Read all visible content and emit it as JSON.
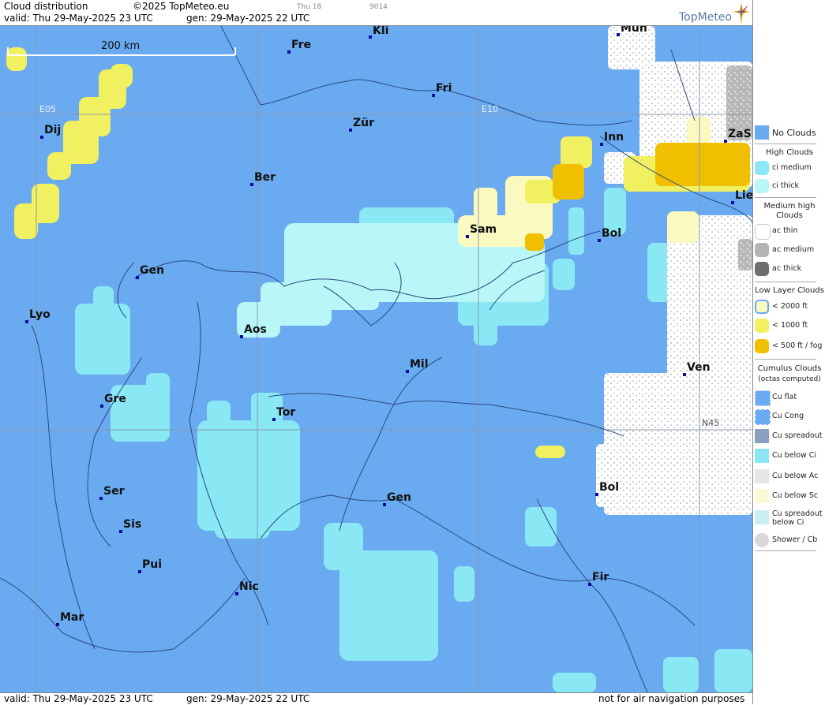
{
  "header": {
    "title": "Cloud distribution",
    "copyright": "©2025 TopMeteo.eu",
    "time_small": "Thu 18",
    "code_small": "9014",
    "valid": "valid:  Thu  29-May-2025  23 UTC",
    "gen": "gen: 29-May-2025 22 UTC",
    "logo": "TopMeteo"
  },
  "footer": {
    "valid": "valid:  Thu  29-May-2025  23 UTC",
    "gen": "gen: 29-May-2025 22 UTC",
    "disclaimer": "not for air navigation purposes"
  },
  "map": {
    "scale_label": "200 km",
    "grid_labels": {
      "e05": "E05",
      "e10": "E10",
      "n45": "N45"
    },
    "cities": [
      {
        "name": "Mun"
      },
      {
        "name": "Kli"
      },
      {
        "name": "Fre"
      },
      {
        "name": "Fri"
      },
      {
        "name": "Dij"
      },
      {
        "name": "Zür"
      },
      {
        "name": "Inn"
      },
      {
        "name": "ZaS"
      },
      {
        "name": "Ber"
      },
      {
        "name": "Lie"
      },
      {
        "name": "Sam"
      },
      {
        "name": "Bol"
      },
      {
        "name": "Gen"
      },
      {
        "name": "Lyo"
      },
      {
        "name": "Aos"
      },
      {
        "name": "Mil"
      },
      {
        "name": "Ven"
      },
      {
        "name": "Gre"
      },
      {
        "name": "Tor"
      },
      {
        "name": "Ser"
      },
      {
        "name": "Gen"
      },
      {
        "name": "Bol"
      },
      {
        "name": "Sis"
      },
      {
        "name": "Pui"
      },
      {
        "name": "Nic"
      },
      {
        "name": "Fir"
      },
      {
        "name": "Mar"
      }
    ]
  },
  "legend": {
    "no_clouds": "No Clouds",
    "high_header": "High Clouds",
    "ci_medium": "ci medium",
    "ci_thick": "ci thick",
    "medium_header_1": "Medium high",
    "medium_header_2": "Clouds",
    "ac_thin": "ac thin",
    "ac_medium": "ac medium",
    "ac_thick": "ac thick",
    "low_header": "Low Layer Clouds",
    "low_2000": "< 2000 ft",
    "low_1000": "< 1000 ft",
    "low_500": "< 500 ft / fog",
    "cu_header_1": "Cumulus Clouds",
    "cu_header_2": "(octas computed)",
    "cu_flat": "Cu flat",
    "cu_cong": "Cu Cong",
    "cu_spreadout": "Cu spreadout",
    "cu_below_ci": "Cu below Ci",
    "cu_below_ac": "Cu below Ac",
    "cu_below_sc": "Cu below Sc",
    "cu_spread_below_ci_1": "Cu spreadout",
    "cu_spread_below_ci_2": "below Ci",
    "shower": "Shower / Cb"
  },
  "colors": {
    "no_clouds": "#6aaaf0",
    "ci_medium": "#8ae8f4",
    "ci_thick": "#a8f0f8",
    "ac_thin": "#ffffff",
    "ac_medium": "#b4b4b4",
    "ac_thick": "#6e6e6e",
    "low_2000": "#fafac0",
    "low_1000": "#f0f060",
    "low_500": "#f0c000"
  }
}
